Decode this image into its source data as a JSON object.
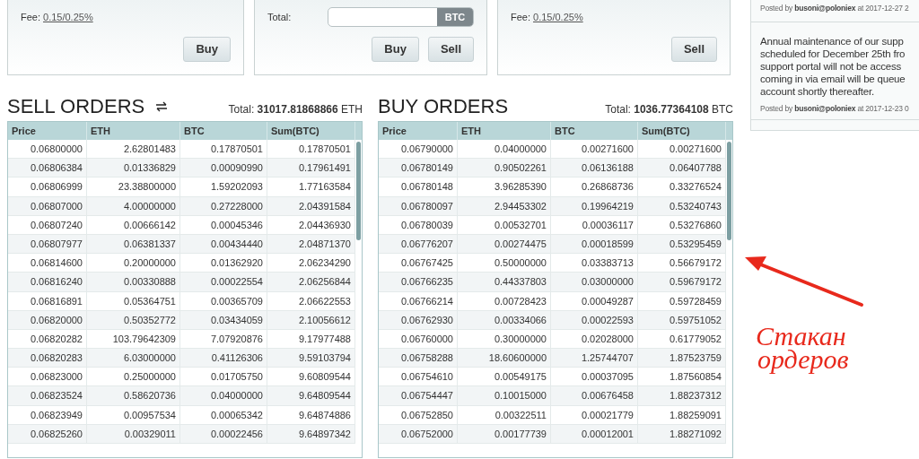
{
  "trade_panels": [
    {
      "kind": "fee",
      "fee_label": "Fee:",
      "fee_value": "0.15/0.25%",
      "buttons": [
        "Buy"
      ]
    },
    {
      "kind": "total",
      "total_label": "Total:",
      "currency": "BTC",
      "buttons": [
        "Buy",
        "Sell"
      ]
    },
    {
      "kind": "fee",
      "fee_label": "Fee:",
      "fee_value": "0.15/0.25%",
      "buttons": [
        "Sell"
      ]
    }
  ],
  "order_books": [
    {
      "title": "SELL ORDERS",
      "swap_icon": true,
      "total_label": "Total:",
      "total_value": "31017.81868866",
      "total_unit": "ETH",
      "columns": [
        "Price",
        "ETH",
        "BTC",
        "Sum(BTC)"
      ],
      "rows": [
        [
          "0.06800000",
          "2.62801483",
          "0.17870501",
          "0.17870501"
        ],
        [
          "0.06806384",
          "0.01336829",
          "0.00090990",
          "0.17961491"
        ],
        [
          "0.06806999",
          "23.38800000",
          "1.59202093",
          "1.77163584"
        ],
        [
          "0.06807000",
          "4.00000000",
          "0.27228000",
          "2.04391584"
        ],
        [
          "0.06807240",
          "0.00666142",
          "0.00045346",
          "2.04436930"
        ],
        [
          "0.06807977",
          "0.06381337",
          "0.00434440",
          "2.04871370"
        ],
        [
          "0.06814600",
          "0.20000000",
          "0.01362920",
          "2.06234290"
        ],
        [
          "0.06816240",
          "0.00330888",
          "0.00022554",
          "2.06256844"
        ],
        [
          "0.06816891",
          "0.05364751",
          "0.00365709",
          "2.06622553"
        ],
        [
          "0.06820000",
          "0.50352772",
          "0.03434059",
          "2.10056612"
        ],
        [
          "0.06820282",
          "103.79642309",
          "7.07920876",
          "9.17977488"
        ],
        [
          "0.06820283",
          "6.03000000",
          "0.41126306",
          "9.59103794"
        ],
        [
          "0.06823000",
          "0.25000000",
          "0.01705750",
          "9.60809544"
        ],
        [
          "0.06823524",
          "0.58620736",
          "0.04000000",
          "9.64809544"
        ],
        [
          "0.06823949",
          "0.00957534",
          "0.00065342",
          "9.64874886"
        ],
        [
          "0.06825260",
          "0.00329011",
          "0.00022456",
          "9.64897342"
        ]
      ]
    },
    {
      "title": "BUY ORDERS",
      "swap_icon": false,
      "total_label": "Total:",
      "total_value": "1036.77364108",
      "total_unit": "BTC",
      "columns": [
        "Price",
        "ETH",
        "BTC",
        "Sum(BTC)"
      ],
      "rows": [
        [
          "0.06790000",
          "0.04000000",
          "0.00271600",
          "0.00271600"
        ],
        [
          "0.06780149",
          "0.90502261",
          "0.06136188",
          "0.06407788"
        ],
        [
          "0.06780148",
          "3.96285390",
          "0.26868736",
          "0.33276524"
        ],
        [
          "0.06780097",
          "2.94453302",
          "0.19964219",
          "0.53240743"
        ],
        [
          "0.06780039",
          "0.00532701",
          "0.00036117",
          "0.53276860"
        ],
        [
          "0.06776207",
          "0.00274475",
          "0.00018599",
          "0.53295459"
        ],
        [
          "0.06767425",
          "0.50000000",
          "0.03383713",
          "0.56679172"
        ],
        [
          "0.06766235",
          "0.44337803",
          "0.03000000",
          "0.59679172"
        ],
        [
          "0.06766214",
          "0.00728423",
          "0.00049287",
          "0.59728459"
        ],
        [
          "0.06762930",
          "0.00334066",
          "0.00022593",
          "0.59751052"
        ],
        [
          "0.06760000",
          "0.30000000",
          "0.02028000",
          "0.61779052"
        ],
        [
          "0.06758288",
          "18.60600000",
          "1.25744707",
          "1.87523759"
        ],
        [
          "0.06754610",
          "0.00549175",
          "0.00037095",
          "1.87560854"
        ],
        [
          "0.06754447",
          "0.10015000",
          "0.00676458",
          "1.88237312"
        ],
        [
          "0.06752850",
          "0.00322511",
          "0.00021779",
          "1.88259091"
        ],
        [
          "0.06752000",
          "0.00177739",
          "0.00012001",
          "1.88271092"
        ]
      ]
    }
  ],
  "news": [
    {
      "posted_prefix": "Posted by",
      "author": "busoni@poloniex",
      "posted_at": "at 2017-12-27 2"
    },
    {
      "body_lines": [
        "Annual maintenance of our supp",
        "scheduled for December 25th fro",
        "support portal will not be access",
        "coming in via email will be queue",
        "account shortly thereafter."
      ],
      "posted_prefix": "Posted by",
      "author": "busoni@poloniex",
      "posted_at": "at 2017-12-23 0"
    }
  ],
  "annotation": {
    "lines": [
      "Стакан",
      "ордеров"
    ]
  }
}
